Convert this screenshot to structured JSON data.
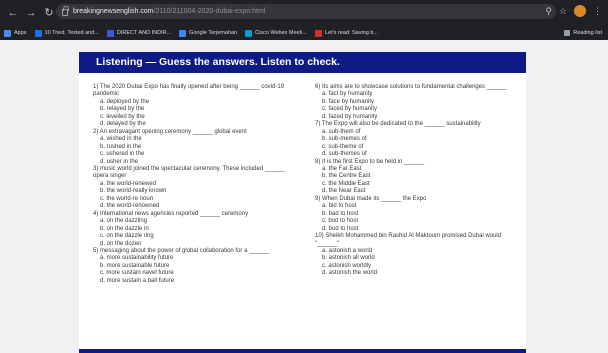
{
  "browser": {
    "url_host": "breakingnewsenglish.com",
    "url_path": "/2110/211004-2020-dubai-expo.html",
    "bookmarks": [
      {
        "label": "Apps",
        "color": "#4a8af4"
      },
      {
        "label": "10 Tried, Tested and...",
        "color": "#1a73e8"
      },
      {
        "label": "DIRECT AND INDIR...",
        "color": "#3b5bd9"
      },
      {
        "label": "Google Terjemahan",
        "color": "#4285f4"
      },
      {
        "label": "Cisco Webex Meeti...",
        "color": "#00a0d1"
      },
      {
        "label": "Let's read: Saving b...",
        "color": "#d93025"
      }
    ],
    "reading_list": "Reading list"
  },
  "banner": {
    "title": "Listening — Guess the answers. Listen to check."
  },
  "questions_left": [
    {
      "q": "1)  The 2020 Dubai Expo has finally opened after being ______ covid-19 pandemic",
      "opts": [
        "a.  deployed by the",
        "b.  relayed by the",
        "c.  levelled by the",
        "d.  delayed by the"
      ]
    },
    {
      "q": "2)  An extravagant opening ceremony ______ global event",
      "opts": [
        "a.  wished in the",
        "b.  rushed in the",
        "c.  ushered in the",
        "d.  usher in the"
      ]
    },
    {
      "q": "3)  music world joined the spectacular ceremony. These included ______ opera singer",
      "opts": [
        "a.  the world-renewed",
        "b.  the world-really known",
        "c.  the world-re noun",
        "d.  the world-renowned"
      ]
    },
    {
      "q": "4)  International news agencies reported ______ ceremony",
      "opts": [
        "a.  on the dazzling",
        "b.  on the dazzle in",
        "c.  on the dazzle ring",
        "d.  on the dozen"
      ]
    },
    {
      "q": "5)  messaging about the power of global collaboration for a ______",
      "opts": [
        "a.  more sustainability future",
        "b.  more sustainable future",
        "c.  more sustain navel future",
        "d.  more sustain a ball future"
      ]
    }
  ],
  "questions_right": [
    {
      "q": "6)  Its aims are to showcase solutions to fundamental challenges ______",
      "opts": [
        "a.  fact by humanity",
        "b.  face by humanity",
        "c.  faced by humanity",
        "d.  fazed by humanity"
      ]
    },
    {
      "q": "7)  The Expo will also be dedicated to the ______ sustainability",
      "opts": [
        "a.  sub-them of",
        "b.  sub-memes of",
        "c.  sub-theme of",
        "d.  sub-themes of"
      ]
    },
    {
      "q": "8)  It is the first Expo to be held in ______",
      "opts": [
        "a.  the Far East",
        "b.  the Centre East",
        "c.  the Middle East",
        "d.  the Near East"
      ]
    },
    {
      "q": "9)  When Dubai made its ______ the Expo",
      "opts": [
        "a.  bid to host",
        "b.  bad to host",
        "c.  bod to host",
        "d.  bud to host"
      ]
    },
    {
      "q": "10)  Sheikh Mohammed bin Rashid Al Maktoum promised Dubai would \"______\"",
      "opts": [
        "a.  astonish a world",
        "b.  astonish all world",
        "c.  astonish worldly",
        "d.  astonish the world"
      ]
    }
  ]
}
